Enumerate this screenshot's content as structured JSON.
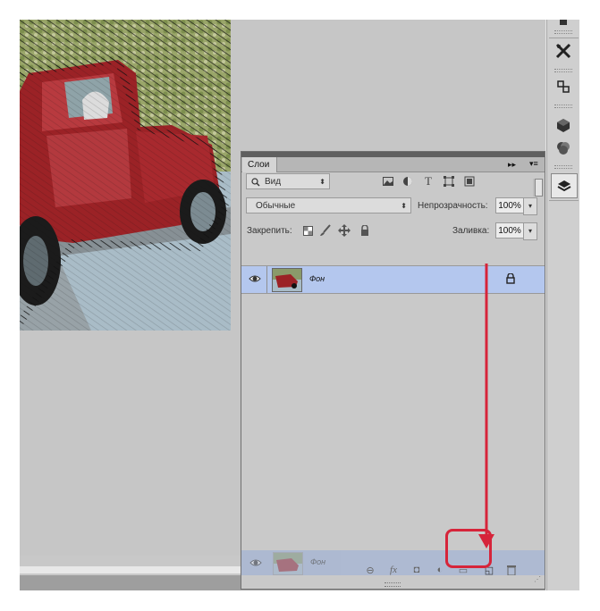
{
  "panel": {
    "tab_label": "Слои",
    "collapse_glyph": "▸▸",
    "menu_glyph": "▾≡",
    "filter": {
      "label": "Вид",
      "icons": [
        "image-filter-icon",
        "adjustment-filter-icon",
        "type-filter-icon",
        "shape-filter-icon",
        "smart-object-filter-icon"
      ]
    },
    "blend_mode": "Обычные",
    "opacity_label": "Непрозрачность:",
    "opacity_value": "100%",
    "lock_label": "Закрепить:",
    "lock_icons": [
      "lock-transparent-icon",
      "lock-image-icon",
      "lock-position-icon",
      "lock-all-icon"
    ],
    "fill_label": "Заливка:",
    "fill_value": "100%",
    "layers": [
      {
        "name": "Фон",
        "visible": true,
        "locked": true,
        "selected": true
      }
    ],
    "dragged_layer": {
      "name": "Фон"
    },
    "footer_icons": [
      "link-layers-icon",
      "fx-icon",
      "add-mask-icon",
      "adjustment-layer-icon",
      "new-group-icon",
      "new-layer-icon",
      "delete-layer-icon"
    ],
    "footer_glyphs": {
      "link": "⊖",
      "fx": "fx",
      "mask": "◘",
      "adjust": "◐",
      "group": "▭",
      "new": "◱"
    }
  },
  "dock": {
    "icons": [
      "adjustments-panel-icon",
      "tools-preset-icon",
      "3d-icon",
      "layers-3d-icon",
      "channels-icon",
      "layers-panel-icon"
    ]
  },
  "annotation": {
    "color": "#d6243a",
    "target": "new-layer-button"
  },
  "colors": {
    "selected_row": "#b4c7ee",
    "panel_bg": "#c9c9c9",
    "canvas_bg": "#c6c6c6"
  }
}
